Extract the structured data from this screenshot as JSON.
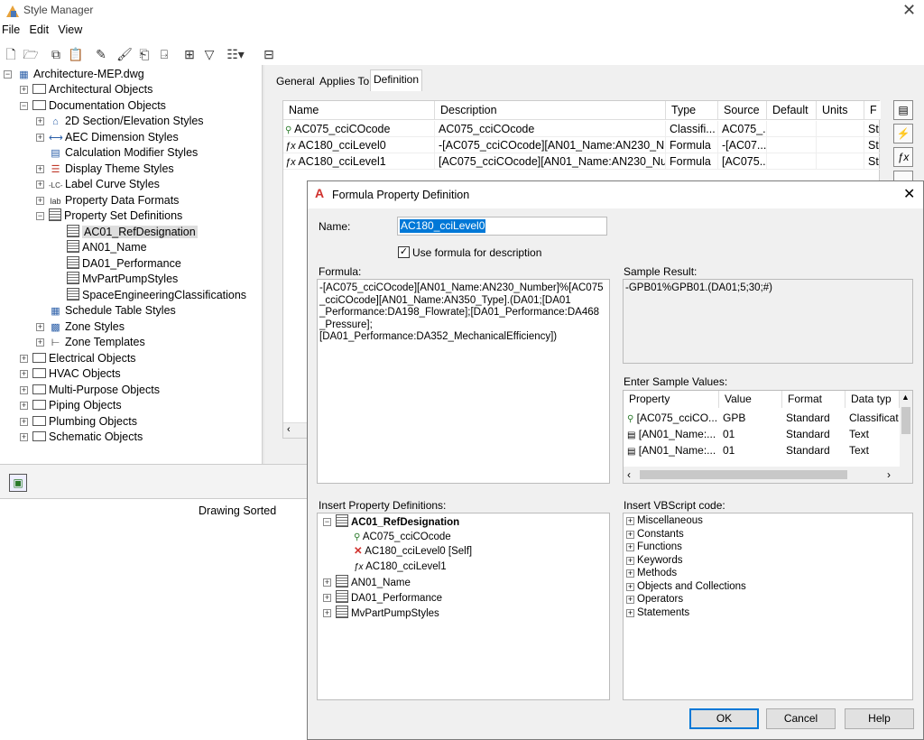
{
  "window": {
    "title": "Style Manager"
  },
  "menu": [
    "File",
    "Edit",
    "View"
  ],
  "tree": {
    "root": "Architecture-MEP.dwg",
    "items": [
      "Architectural Objects",
      "Documentation Objects",
      "2D Section/Elevation Styles",
      "AEC Dimension Styles",
      "Calculation Modifier Styles",
      "Display Theme Styles",
      "Label Curve Styles",
      "Property Data Formats",
      "Property Set Definitions",
      "AC01_RefDesignation",
      "AN01_Name",
      "DA01_Performance",
      "MvPartPumpStyles",
      "SpaceEngineeringClassifications",
      "Schedule Table Styles",
      "Zone Styles",
      "Zone Templates",
      "Electrical Objects",
      "HVAC Objects",
      "Multi-Purpose Objects",
      "Piping Objects",
      "Plumbing Objects",
      "Schematic Objects"
    ],
    "label_curve_glyph": "-LC-",
    "property_data_glyph": "lab"
  },
  "status": {
    "text": "Drawing Sorted"
  },
  "tabs": [
    "General",
    "Applies To",
    "Definition"
  ],
  "grid": {
    "headers": [
      "Name",
      "Description",
      "Type",
      "Source",
      "Default",
      "Units",
      "F"
    ],
    "rows": [
      {
        "name": "AC075_cciCOcode",
        "description": "AC075_cciCOcode",
        "type": "Classifi...",
        "source": "AC075_...",
        "default": "",
        "units": "",
        "f": "St"
      },
      {
        "name": "AC180_cciLevel0",
        "description": "-[AC075_cciCOcode][AN01_Name:AN230_N...",
        "type": "Formula",
        "source": "-[AC07...",
        "default": "",
        "units": "",
        "f": "St"
      },
      {
        "name": "AC180_cciLevel1",
        "description": "[AC075_cciCOcode][AN01_Name:AN230_Nu...",
        "type": "Formula",
        "source": "[AC075...",
        "default": "",
        "units": "",
        "f": "St"
      }
    ]
  },
  "dialog": {
    "title": "Formula Property Definition",
    "name_label": "Name:",
    "name_value": "AC180_cciLevel0",
    "use_formula_label": "Use formula for description",
    "use_formula_checked": true,
    "formula_label": "Formula:",
    "formula_lines": [
      "-[AC075_cciCOcode][AN01_Name:AN230_Number]%[AC075",
      "_cciCOcode][AN01_Name:AN350_Type].(DA01;[DA01",
      "_Performance:DA198_Flowrate];[DA01_Performance:DA468",
      "_Pressure];[DA01_Performance:DA352_MechanicalEfficiency])"
    ],
    "sample_result_label": "Sample Result:",
    "sample_result": "-GPB01%GPB01.(DA01;5;30;#)",
    "sample_values_label": "Enter Sample Values:",
    "sample_headers": [
      "Property",
      "Value",
      "Format",
      "Data typ"
    ],
    "sample_rows": [
      {
        "property": "[AC075_cciCO...",
        "value": "GPB",
        "format": "Standard",
        "datatype": "Classificat"
      },
      {
        "property": "[AN01_Name:...",
        "value": "01",
        "format": "Standard",
        "datatype": "Text"
      },
      {
        "property": "[AN01_Name:...",
        "value": "01",
        "format": "Standard",
        "datatype": "Text"
      }
    ],
    "insert_prop_label": "Insert Property Definitions:",
    "prop_tree": {
      "group1": "AC01_RefDesignation",
      "children": [
        "AC075_cciCOcode",
        "AC180_cciLevel0 [Self]",
        "AC180_cciLevel1"
      ],
      "others": [
        "AN01_Name",
        "DA01_Performance",
        "MvPartPumpStyles"
      ]
    },
    "insert_vb_label": "Insert VBScript code:",
    "vb_items": [
      "Miscellaneous",
      "Constants",
      "Functions",
      "Keywords",
      "Methods",
      "Objects and Collections",
      "Operators",
      "Statements"
    ],
    "ok_label": "OK",
    "cancel_label": "Cancel",
    "help_label": "Help"
  }
}
